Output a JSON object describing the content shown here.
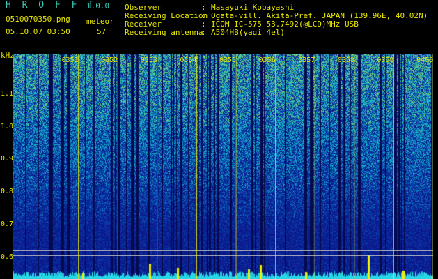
{
  "header": {
    "app_name": "H R O F F T",
    "version": "1.0.0",
    "filename": "0510070350.png",
    "meteor_label": "meteor",
    "datetime": "05.10.07 03:50",
    "meteor_count": "57"
  },
  "info": [
    {
      "label": "Observer",
      "value": "Masayuki Kobayashi"
    },
    {
      "label": "Receiving Location",
      "value": "Ogata-vill. Akita-Pref. JAPAN (139.96E, 40.02N)"
    },
    {
      "label": "Receiver",
      "value": "ICOM IC-575 53.7492(@LCD)MHz USB"
    },
    {
      "label": "Receiving antenna",
      "value": "A504HB(yagi 4el)"
    }
  ],
  "axis": {
    "unit": "kHz",
    "y_ticks": [
      "1.1",
      "1.0",
      "0.9",
      "0.8",
      "0.7",
      "0.6"
    ],
    "y_values": [
      1.1,
      1.0,
      0.9,
      0.8,
      0.7,
      0.6
    ],
    "ylim": [
      0.58,
      1.2
    ],
    "time_ticks": [
      "0351",
      "0352",
      "0353",
      "0354",
      "0355",
      "0356",
      "0357",
      "0358",
      "0359",
      "0400"
    ],
    "time_minutes": [
      1,
      2,
      3,
      4,
      5,
      6,
      7,
      8,
      9,
      10
    ],
    "xlim_minutes": [
      0,
      10
    ]
  },
  "colors": {
    "text": "#e8e800",
    "title": "#39c9b5",
    "background": "#000000",
    "spectrum_low": "#0a1a8c",
    "spectrum_high": "#39c9b5"
  }
}
